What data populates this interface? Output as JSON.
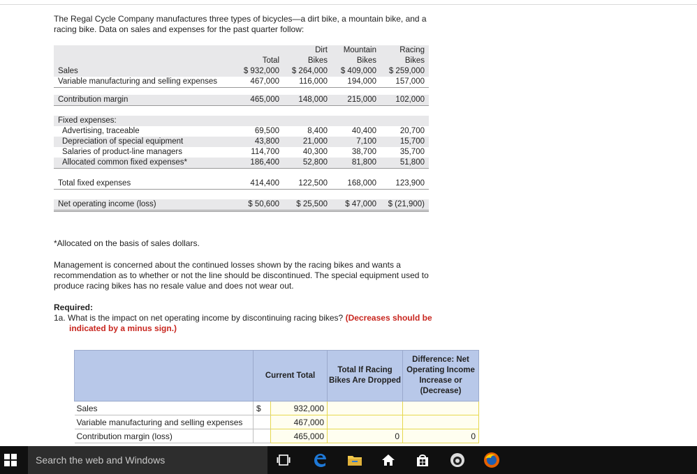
{
  "intro": "The Regal Cycle Company manufactures three types of bicycles—a dirt bike, a mountain bike, and a racing bike. Data on sales and expenses for the past quarter follow:",
  "table": {
    "headers": {
      "total": "Total",
      "dirt_top": "Dirt",
      "dirt_bottom": "Bikes",
      "mountain_top": "Mountain",
      "mountain_bottom": "Bikes",
      "racing_top": "Racing",
      "racing_bottom": "Bikes"
    },
    "sales": {
      "label": "Sales",
      "values": [
        "$ 932,000",
        "$ 264,000",
        "$ 409,000",
        "$ 259,000"
      ]
    },
    "variable": {
      "label": "Variable manufacturing and selling expenses",
      "values": [
        "467,000",
        "116,000",
        "194,000",
        "157,000"
      ]
    },
    "contribution": {
      "label": "Contribution margin",
      "values": [
        "465,000",
        "148,000",
        "215,000",
        "102,000"
      ]
    },
    "fixed_label": "Fixed expenses:",
    "fixed_items": [
      {
        "label": "Advertising, traceable",
        "values": [
          "69,500",
          "8,400",
          "40,400",
          "20,700"
        ]
      },
      {
        "label": "Depreciation of special equipment",
        "values": [
          "43,800",
          "21,000",
          "7,100",
          "15,700"
        ]
      },
      {
        "label": "Salaries of product-line managers",
        "values": [
          "114,700",
          "40,300",
          "38,700",
          "35,700"
        ]
      },
      {
        "label": "Allocated common fixed expenses*",
        "values": [
          "186,400",
          "52,800",
          "81,800",
          "51,800"
        ]
      }
    ],
    "total_fixed": {
      "label": "Total fixed expenses",
      "values": [
        "414,400",
        "122,500",
        "168,000",
        "123,900"
      ]
    },
    "noi": {
      "label": "Net operating income (loss)",
      "values": [
        "$  50,600",
        "$  25,500",
        "$  47,000",
        "$ (21,900)"
      ]
    }
  },
  "footnote": "*Allocated on the basis of sales dollars.",
  "management": "Management is concerned about the continued losses shown by the racing bikes and wants a recommendation as to whether or not the line should be discontinued. The special equipment used to produce racing bikes has no resale value and does not wear out.",
  "required": {
    "heading": "Required:",
    "question_prefix": "1a. What is the impact on net operating income by discontinuing racing bikes?",
    "question_note_1": "(Decreases should be",
    "question_note_2": "indicated by a minus sign.)"
  },
  "answer_table": {
    "headers": {
      "current": "Current Total",
      "dropped": "Total If Racing Bikes Are Dropped",
      "difference": "Difference: Net Operating Income Increase or (Decrease)"
    },
    "rows": [
      {
        "label": "Sales",
        "dollar": "$",
        "current": "932,000",
        "dropped": "",
        "difference": ""
      },
      {
        "label": "Variable manufacturing and selling expenses",
        "dollar": "",
        "current": "467,000",
        "dropped": "",
        "difference": ""
      },
      {
        "label": "Contribution margin (loss)",
        "dollar": "",
        "current": "465,000",
        "dropped": "0",
        "difference": "0"
      }
    ]
  },
  "taskbar": {
    "search_placeholder": "Search the web and Windows",
    "colors": {
      "bar": "#101010",
      "search": "#2d2d2d",
      "edge": "#1e78d6",
      "store": "#ffffff"
    }
  }
}
